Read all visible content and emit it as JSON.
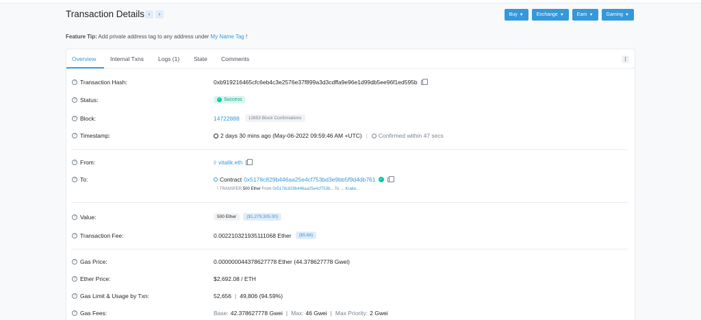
{
  "header": {
    "title": "Transaction Details",
    "prev_arrow": "‹",
    "next_arrow": "›",
    "buttons": [
      {
        "label": "Buy"
      },
      {
        "label": "Exchange"
      },
      {
        "label": "Earn"
      },
      {
        "label": "Gaming"
      }
    ]
  },
  "feature_tip": {
    "prefix": "Feature Tip:",
    "text": "Add private address tag to any address under",
    "link": "My Name Tag",
    "suffix": "!"
  },
  "tabs": [
    {
      "label": "Overview"
    },
    {
      "label": "Internal Txns"
    },
    {
      "label": "Logs (1)"
    },
    {
      "label": "State"
    },
    {
      "label": "Comments"
    }
  ],
  "details": {
    "tx_hash": {
      "label": "Transaction Hash:",
      "value": "0xb919216465cfc6eb4c3e2576e37f899a3d3cdffa9e96e1d99db5ee96f1ed595b"
    },
    "status": {
      "label": "Status:",
      "value": "Success"
    },
    "block": {
      "label": "Block:",
      "value": "14722888",
      "confirmations": "12653 Block Confirmations"
    },
    "timestamp": {
      "label": "Timestamp:",
      "value": "2 days 30 mins ago (May-06-2022 09:59:46 AM +UTC)",
      "confirmed": "Confirmed within 47 secs"
    },
    "from": {
      "label": "From:",
      "value": "vitalik.eth"
    },
    "to": {
      "label": "To:",
      "prefix": "Contract",
      "value": "0x5178c829b446aa25e4cf753bd3e9bb5f9d4db761",
      "transfer_label": "└ TRANSFER",
      "transfer_amount": "500 Ether",
      "transfer_from_label": "From",
      "transfer_from": "0x5178c829b446aa25e4cf753b...",
      "transfer_to_label": "To →",
      "transfer_to": "Krake..."
    },
    "value": {
      "label": "Value:",
      "ether": "500 Ether",
      "usd": "($1,279,305.00)"
    },
    "fee": {
      "label": "Transaction Fee:",
      "value": "0.002210321935111068 Ether",
      "usd": "($5.66)"
    },
    "gas_price": {
      "label": "Gas Price:",
      "value": "0.000000044378627778 Ether (44.378627778 Gwei)"
    },
    "ether_price": {
      "label": "Ether Price:",
      "value": "$2,692.08 / ETH"
    },
    "gas_limit": {
      "label": "Gas Limit & Usage by Txn:",
      "limit": "52,656",
      "usage": "49,806 (94.59%)"
    },
    "gas_fees": {
      "label": "Gas Fees:",
      "base_label": "Base:",
      "base": "42.378627778 Gwei",
      "max_label": "Max:",
      "max": "46 Gwei",
      "priority_label": "Max Priority:",
      "priority": "2 Gwei"
    }
  },
  "icons": {
    "help": "?",
    "more": "⋮",
    "check": "✓"
  },
  "colors": {
    "accent": "#3498db",
    "success": "#00c9a7"
  }
}
